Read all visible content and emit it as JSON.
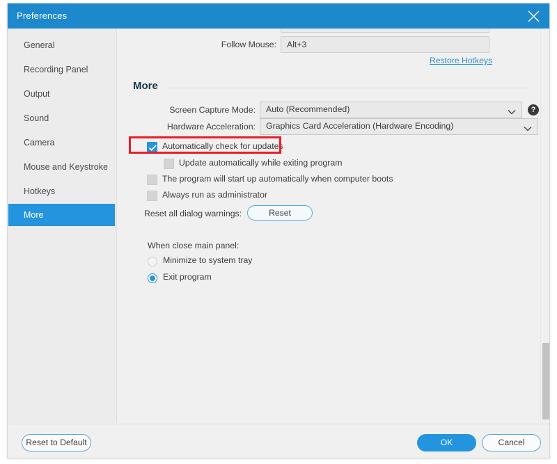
{
  "window": {
    "title": "Preferences",
    "close_icon": "close-icon"
  },
  "sidebar": {
    "items": [
      {
        "label": "General",
        "active": false
      },
      {
        "label": "Recording Panel",
        "active": false
      },
      {
        "label": "Output",
        "active": false
      },
      {
        "label": "Sound",
        "active": false
      },
      {
        "label": "Camera",
        "active": false
      },
      {
        "label": "Mouse and Keystroke",
        "active": false
      },
      {
        "label": "Hotkeys",
        "active": false
      },
      {
        "label": "More",
        "active": true
      }
    ]
  },
  "hotkeys_section": {
    "follow_mouse_label": "Follow Mouse:",
    "follow_mouse_value": "Alt+3",
    "restore_link": "Restore Hotkeys"
  },
  "more_section": {
    "title": "More",
    "screen_capture_mode": {
      "label": "Screen Capture Mode:",
      "value": "Auto (Recommended)",
      "help_icon": "question-mark-icon"
    },
    "hardware_acceleration": {
      "label": "Hardware Acceleration:",
      "value": "Graphics Card Acceleration (Hardware Encoding)"
    },
    "checkboxes": [
      {
        "label": "Automatically check for updates",
        "checked": true,
        "indent": 0
      },
      {
        "label": "Update automatically while exiting program",
        "checked": false,
        "indent": 1
      },
      {
        "label": "The program will start up automatically when computer boots",
        "checked": false,
        "indent": 0
      },
      {
        "label": "Always run as administrator",
        "checked": false,
        "indent": 0
      }
    ],
    "reset_warnings": {
      "label": "Reset all dialog warnings:",
      "button": "Reset"
    },
    "close_panel": {
      "label": "When close main panel:",
      "options": [
        {
          "label": "Minimize to system tray",
          "selected": false
        },
        {
          "label": "Exit program",
          "selected": true
        }
      ]
    }
  },
  "footer": {
    "reset_to_default": "Reset to Default",
    "ok": "OK",
    "cancel": "Cancel"
  },
  "colors": {
    "accent": "#2394dd",
    "titlebar": "#1e88cd",
    "highlight": "#ee1b24",
    "link": "#2d8fd4"
  }
}
